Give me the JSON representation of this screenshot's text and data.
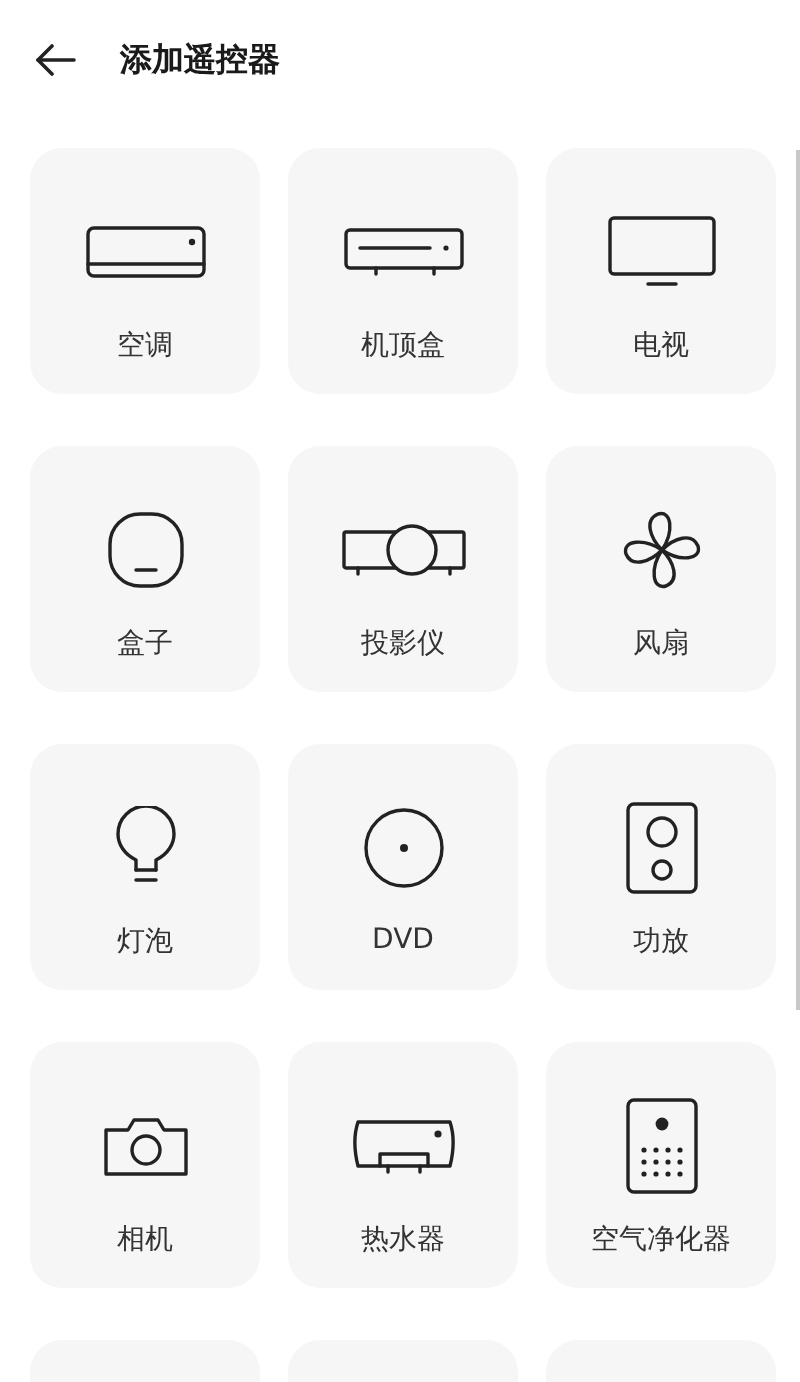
{
  "header": {
    "title": "添加遥控器"
  },
  "devices": [
    {
      "kind": "ac",
      "label": "空调"
    },
    {
      "kind": "settopbox",
      "label": "机顶盒"
    },
    {
      "kind": "tv",
      "label": "电视"
    },
    {
      "kind": "box",
      "label": "盒子"
    },
    {
      "kind": "projector",
      "label": "投影仪"
    },
    {
      "kind": "fan",
      "label": "风扇"
    },
    {
      "kind": "bulb",
      "label": "灯泡"
    },
    {
      "kind": "disc",
      "label": "DVD"
    },
    {
      "kind": "speaker",
      "label": "功放"
    },
    {
      "kind": "camera",
      "label": "相机"
    },
    {
      "kind": "heater",
      "label": "热水器"
    },
    {
      "kind": "purifier",
      "label": "空气净化器"
    },
    {
      "kind": "cut"
    },
    {
      "kind": "cut"
    },
    {
      "kind": "cut"
    }
  ]
}
